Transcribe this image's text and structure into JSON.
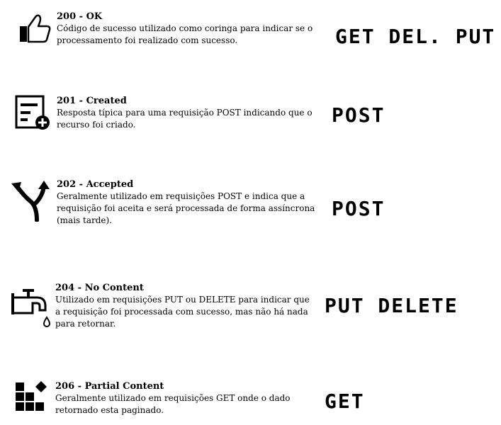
{
  "items": [
    {
      "code": "200 - OK",
      "description": "Código de sucesso utilizado como coringa para indicar se o processamento foi realizado com sucesso.",
      "methods": "GET DEL. PUT",
      "icon": "thumbs-up-icon"
    },
    {
      "code": "201 - Created",
      "description": "Resposta típica para uma requisição POST indicando que o recurso foi criado.",
      "methods": "POST",
      "icon": "new-document-icon"
    },
    {
      "code": "202 - Accepted",
      "description": "Geralmente utilizado em requisições POST e indica que a requisição foi aceita e será processada de forma assíncrona (mais tarde).",
      "methods": "POST",
      "icon": "split-arrows-icon"
    },
    {
      "code": "204 - No Content",
      "description": "Utilizado em requisições PUT ou DELETE para indicar que a requisição foi processada com sucesso, mas não há nada para retornar.",
      "methods": "PUT DELETE",
      "icon": "faucet-icon"
    },
    {
      "code": "206 - Partial Content",
      "description": "Geralmente utilizado em requisições GET onde o dado retornado esta paginado.",
      "methods": "GET",
      "icon": "blocks-icon"
    }
  ]
}
